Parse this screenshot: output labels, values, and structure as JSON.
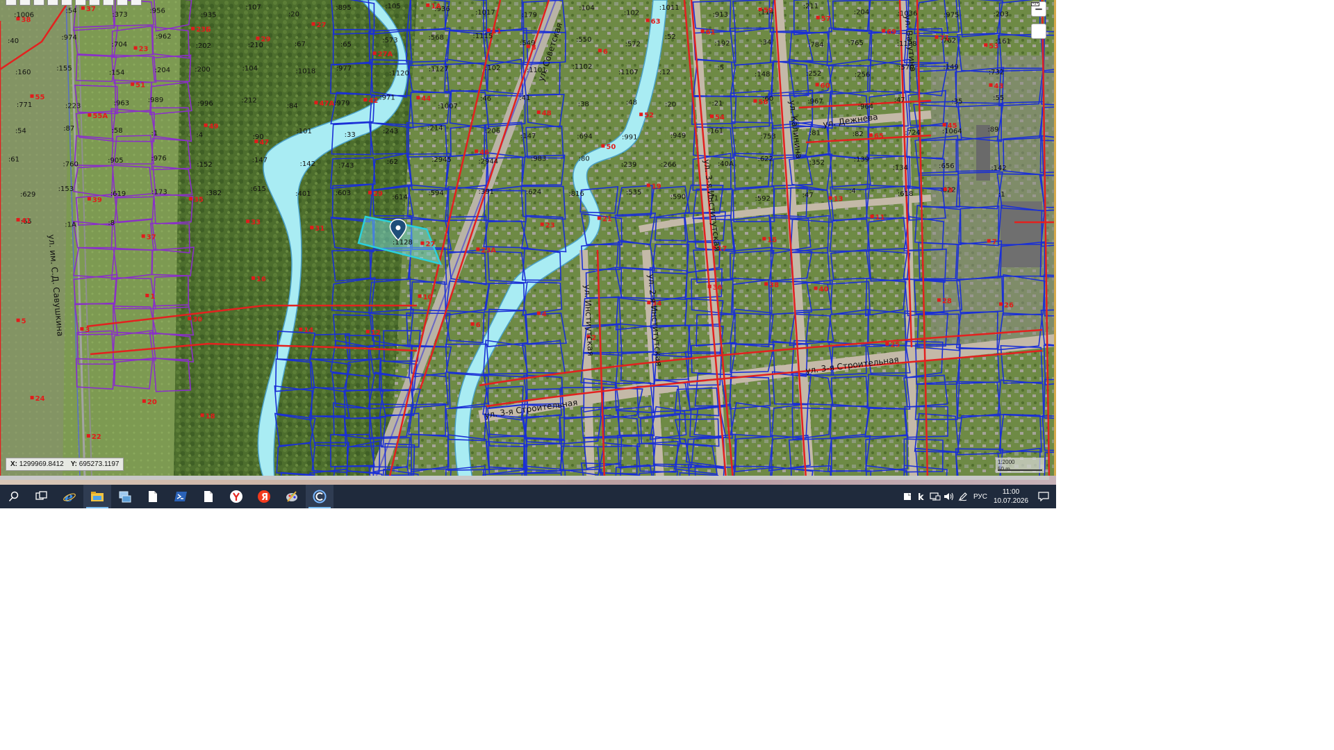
{
  "toolbar": {
    "items": [
      "identify-icon",
      "print-icon",
      "layers-icon",
      "copy-icon",
      "tool-icon",
      "map-icon",
      "table-icon",
      "save-icon",
      "measure-icon",
      "cart-icon"
    ]
  },
  "map": {
    "street_labels": [
      "ул. Советская",
      "ул. 3-я Строительная",
      "ул. 3-я Строительная",
      "ул. 3-я Институтская",
      "ул. 2-я Институтская",
      "ул. Инстиутская",
      "ул. Калинина",
      "ул. Дежнева",
      "ул. Ватутина",
      "ул. им. С.Д. Савушкина"
    ],
    "parcel_labels": [
      ":1006",
      ":54",
      ":373",
      ":956",
      ":935",
      ":107",
      ":20",
      ":895",
      ":105",
      ":936",
      ":1017",
      ":179",
      ":104",
      ":102",
      ":1011",
      ":913",
      ":114",
      ":211",
      ":204",
      ":1036",
      ":975",
      ":203",
      ":40",
      ":974",
      ":704",
      ":962",
      ":202",
      ":210",
      ":67",
      ":65",
      ":573",
      ":568",
      ":1115",
      ":549",
      ":550",
      ":572",
      ":52",
      ":192",
      ":34",
      ":784",
      ":765",
      ":1128",
      ":762",
      ":161",
      ":160",
      ":155",
      ":154",
      ":204",
      ":200",
      ":104",
      ":1018",
      ":977",
      ":1120",
      ":1127",
      ":102",
      ":1101",
      ":1102",
      ":1107",
      ":12",
      ":5",
      ":148",
      ":252",
      ":256",
      ":570",
      ":149",
      ":732",
      ":771",
      ":223",
      ":963",
      ":989",
      ":996",
      ":212",
      ":84",
      ":979",
      ":971",
      ":1007",
      ":46",
      ":41",
      ":38",
      ":48",
      ":20",
      ":21",
      ":60",
      ":967",
      ":964",
      ":47",
      ":35",
      ":55",
      ":54",
      ":87",
      ":58",
      ":1",
      ":4",
      ":90",
      ":101",
      ":33",
      ":243",
      ":214",
      ":206",
      ":147",
      ":694",
      ":991",
      ":949",
      ":161",
      ":753",
      ":81",
      ":82",
      ":724",
      ":1064",
      ":89",
      ":61",
      ":760",
      ":905",
      ":976",
      ":152",
      ":147",
      ":142",
      ":743",
      ":62",
      ":2945",
      ":2944",
      ":983",
      ":80",
      ":239",
      ":266",
      ":40А",
      ":622",
      ":352",
      ":139",
      ":134",
      ":656",
      ":142",
      ":629",
      ":153",
      ":619",
      ":173",
      ":382",
      ":615",
      ":401",
      ":603",
      ":614",
      ":594",
      ":391",
      ":624",
      ":816",
      ":535",
      ":590",
      ":71",
      ":592",
      ":47",
      ":4",
      ":618",
      ":622",
      ":1",
      ":65",
      ":1А",
      ":8"
    ],
    "house_numbers": [
      "38",
      "37",
      "23",
      "23Б",
      "29",
      "27",
      "27А",
      "1А",
      "11",
      "8",
      "6",
      "63",
      "61",
      "59",
      "57",
      "69",
      "71",
      "53",
      "55",
      "55А",
      "51",
      "49",
      "47",
      "47А",
      "42",
      "44",
      "46",
      "48",
      "50",
      "52",
      "54",
      "56",
      "60",
      "65",
      "45",
      "43",
      "41",
      "39",
      "37",
      "35",
      "33",
      "31",
      "29",
      "27",
      "23А",
      "23",
      "21",
      "19",
      "17",
      "15",
      "13",
      "11",
      "9",
      "7",
      "5",
      "3",
      "1",
      "30",
      "16",
      "14",
      "12",
      "10",
      "6",
      "4",
      "2",
      "34",
      "36",
      "38",
      "40",
      "25",
      "28",
      "26",
      "24",
      "22",
      "20",
      "18"
    ],
    "selected_parcel": ":1128"
  },
  "coords": {
    "x_label": "X:",
    "x_value": "1299969.8412",
    "y_label": "Y:",
    "y_value": "695273.1197"
  },
  "scale": {
    "ratio": "1:2000",
    "distance": "50 m"
  },
  "zoom": {
    "in_label": "+",
    "out_label": "−"
  },
  "taskbar": {
    "apps": [
      "search-icon",
      "task-view-icon",
      "internet-explorer-icon",
      "file-explorer-icon",
      "network-computer-icon",
      "document-icon",
      "powershell-icon",
      "document-icon",
      "yandex-browser-icon",
      "yandex-icon",
      "paint-icon",
      "camera-app-icon"
    ],
    "language": "РУС",
    "time": "11:00",
    "date": "10.07.2026"
  }
}
